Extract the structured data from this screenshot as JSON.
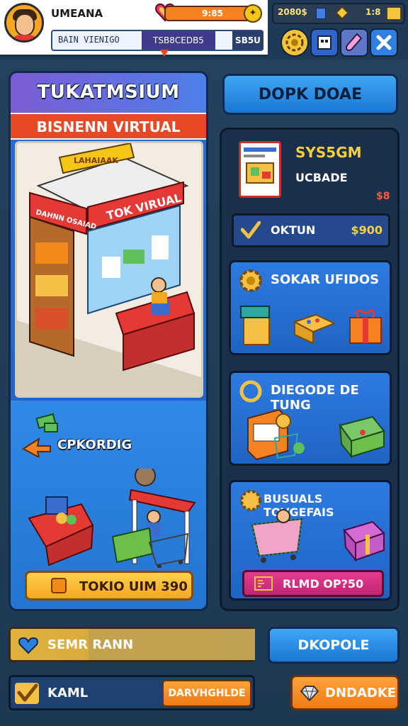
{
  "player": {
    "name": "UMEANA",
    "status": "BAIN VIENIGO",
    "rank": "TSB8CEDB5",
    "level": "SB5U",
    "health": "9:85"
  },
  "currency": {
    "coins": "2080$",
    "gems": "1:8"
  },
  "top_buttons": [
    "settings",
    "map",
    "potion",
    "close"
  ],
  "left_panel": {
    "title": "TUKATMSIUM",
    "banner": "BISNENN VIRTUAL",
    "shop_sign": "TOK VIRUAL",
    "shop_roof_sign": "LAHAIAAK",
    "shop_side_sign": "DAHNN OSAIAD",
    "checkout_label": "CPKORDIG",
    "buy_button": "TOKIO UIM 390"
  },
  "action_button": "DOPK DOAE",
  "product": {
    "name": "SYS5GM",
    "subtitle": "UCBADE",
    "price": "$8"
  },
  "cost_row": {
    "label": "OKTUN",
    "value": "$900"
  },
  "cards": [
    {
      "title": "SOKAR UFIDOS"
    },
    {
      "title": "DIEGODE DE TUNG"
    },
    {
      "title": "BUSUALS TOVGEFAIS",
      "button": "RLMD OP?50"
    }
  ],
  "bottom": {
    "search_label": "SEMR RANN",
    "explore_button": "DKOPOLE",
    "input_label": "KAML",
    "input_action": "DARVHGHLDE",
    "upgrade_button": "DNDADKE"
  },
  "colors": {
    "panel_blue": "#2a6dd2",
    "banner_red": "#e94826",
    "accent_yellow": "#f7d03c",
    "button_orange": "#f5a623",
    "button_pink": "#c12674"
  }
}
